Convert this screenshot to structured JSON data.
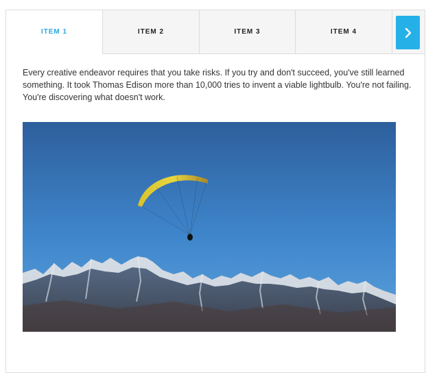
{
  "tabs": [
    {
      "label": "ITEM 1",
      "active": true
    },
    {
      "label": "ITEM 2",
      "active": false
    },
    {
      "label": "ITEM 3",
      "active": false
    },
    {
      "label": "ITEM 4",
      "active": false
    }
  ],
  "next_button": {
    "icon": "chevron-right-icon"
  },
  "panel": {
    "text": "Every creative endeavor requires that you take risks. If you try and don't succeed, you've still learned something. It took Thomas Edison more than 10,000 tries to invent a viable lightbulb. You're not failing. You're discovering what doesn't work."
  },
  "colors": {
    "accent": "#25b1e8",
    "active_tab_text": "#2aa8e0",
    "tab_background": "#f5f5f5",
    "border": "#dcdcdc"
  }
}
